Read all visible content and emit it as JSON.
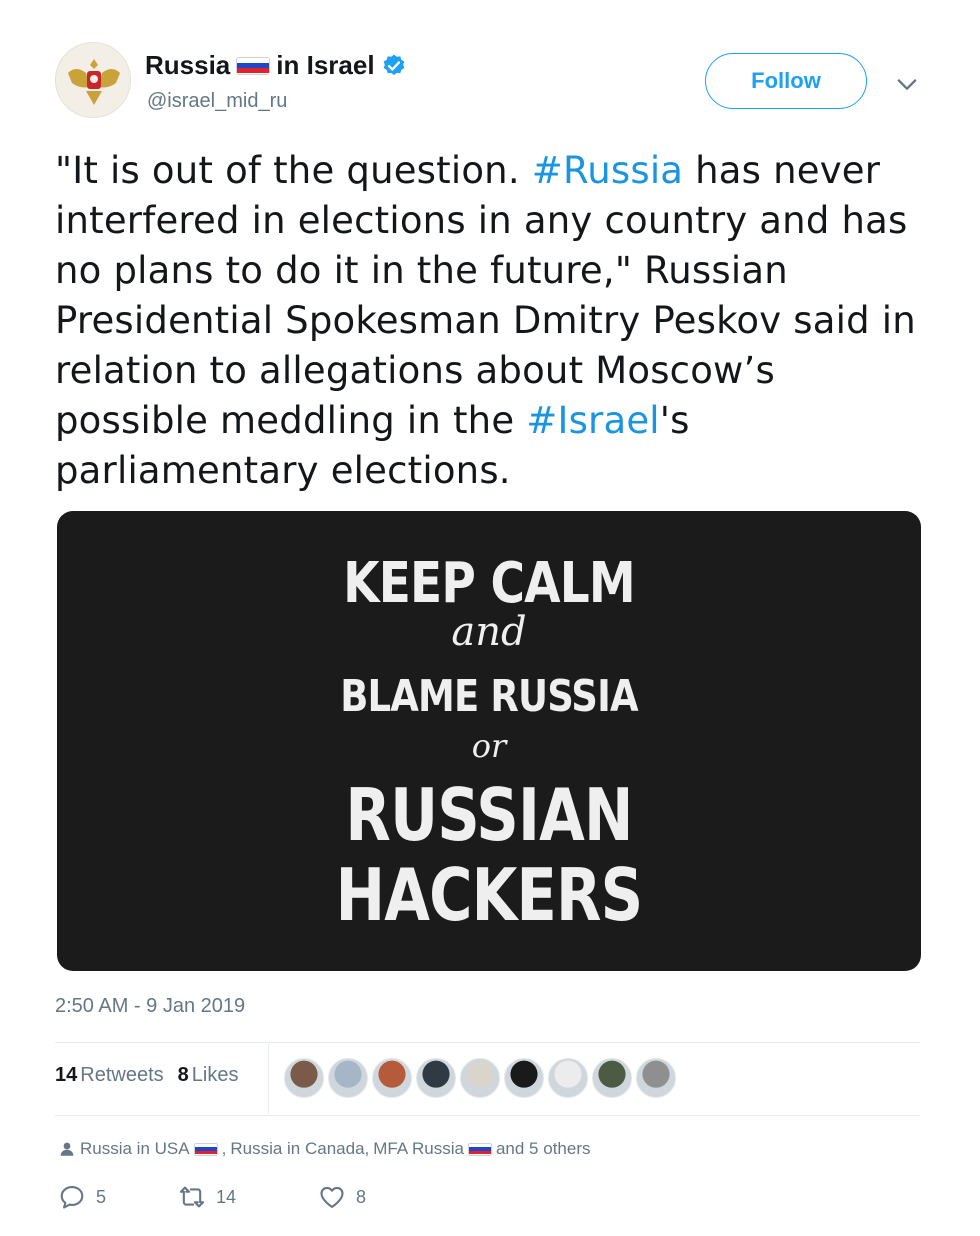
{
  "author": {
    "display_name_part1": "Russia",
    "display_name_part2": "in Israel",
    "handle": "@israel_mid_ru",
    "verified": true,
    "flag_colors": [
      "#ffffff",
      "#1f46c7",
      "#e0222b"
    ],
    "avatar_icon": "coat-of-arms-eagle"
  },
  "follow_button": {
    "label": "Follow",
    "color": "#1da1f2"
  },
  "tweet": {
    "lines": [
      [
        {
          "t": "\"It is out of the question. "
        },
        {
          "t": "#Russia",
          "h": true
        },
        {
          "t": " has never"
        }
      ],
      [
        {
          "t": "interfered in elections in any country and has"
        }
      ],
      [
        {
          "t": "no plans to do it in the future,\" Russian"
        }
      ],
      [
        {
          "t": "Presidential Spokesman Dmitry Peskov said in"
        }
      ],
      [
        {
          "t": "relation to allegations about Moscow’s"
        }
      ],
      [
        {
          "t": "possible meddling in the "
        },
        {
          "t": "#Israel",
          "h": true
        },
        {
          "t": "'s"
        }
      ],
      [
        {
          "t": "parliamentary elections."
        }
      ]
    ],
    "hashtag_color": "#1b95e0"
  },
  "media": {
    "line1": "KEEP CALM",
    "line2": "and",
    "line3": "BLAME RUSSIA",
    "line4": "or",
    "line5": "RUSSIAN",
    "line6": "HACKERS"
  },
  "timestamp": "2:50 AM - 9 Jan 2019",
  "stats": {
    "retweets_count": "14",
    "retweets_label": "Retweets",
    "likes_count": "8",
    "likes_label": "Likes"
  },
  "likers": [
    {
      "name": "liker-avatar-1",
      "color": "#7a5a48"
    },
    {
      "name": "liker-avatar-2",
      "color": "#a7b6c7"
    },
    {
      "name": "liker-avatar-3",
      "color": "#b55a3a"
    },
    {
      "name": "liker-avatar-4",
      "color": "#2f3a44"
    },
    {
      "name": "liker-avatar-5",
      "color": "#d9d4cc"
    },
    {
      "name": "liker-avatar-6",
      "color": "#1a1a1a"
    },
    {
      "name": "liker-avatar-7",
      "color": "#ececec"
    },
    {
      "name": "liker-avatar-8",
      "color": "#4d5a44"
    },
    {
      "name": "liker-avatar-9",
      "color": "#8f8f8f"
    }
  ],
  "context": {
    "account1": "Russia in USA",
    "sep1": ",",
    "account2": "Russia in Canada,",
    "account3": "MFA Russia",
    "others": "and 5 others"
  },
  "actions": {
    "replies": "5",
    "retweets": "14",
    "likes": "8",
    "icon_color": "#657786"
  }
}
